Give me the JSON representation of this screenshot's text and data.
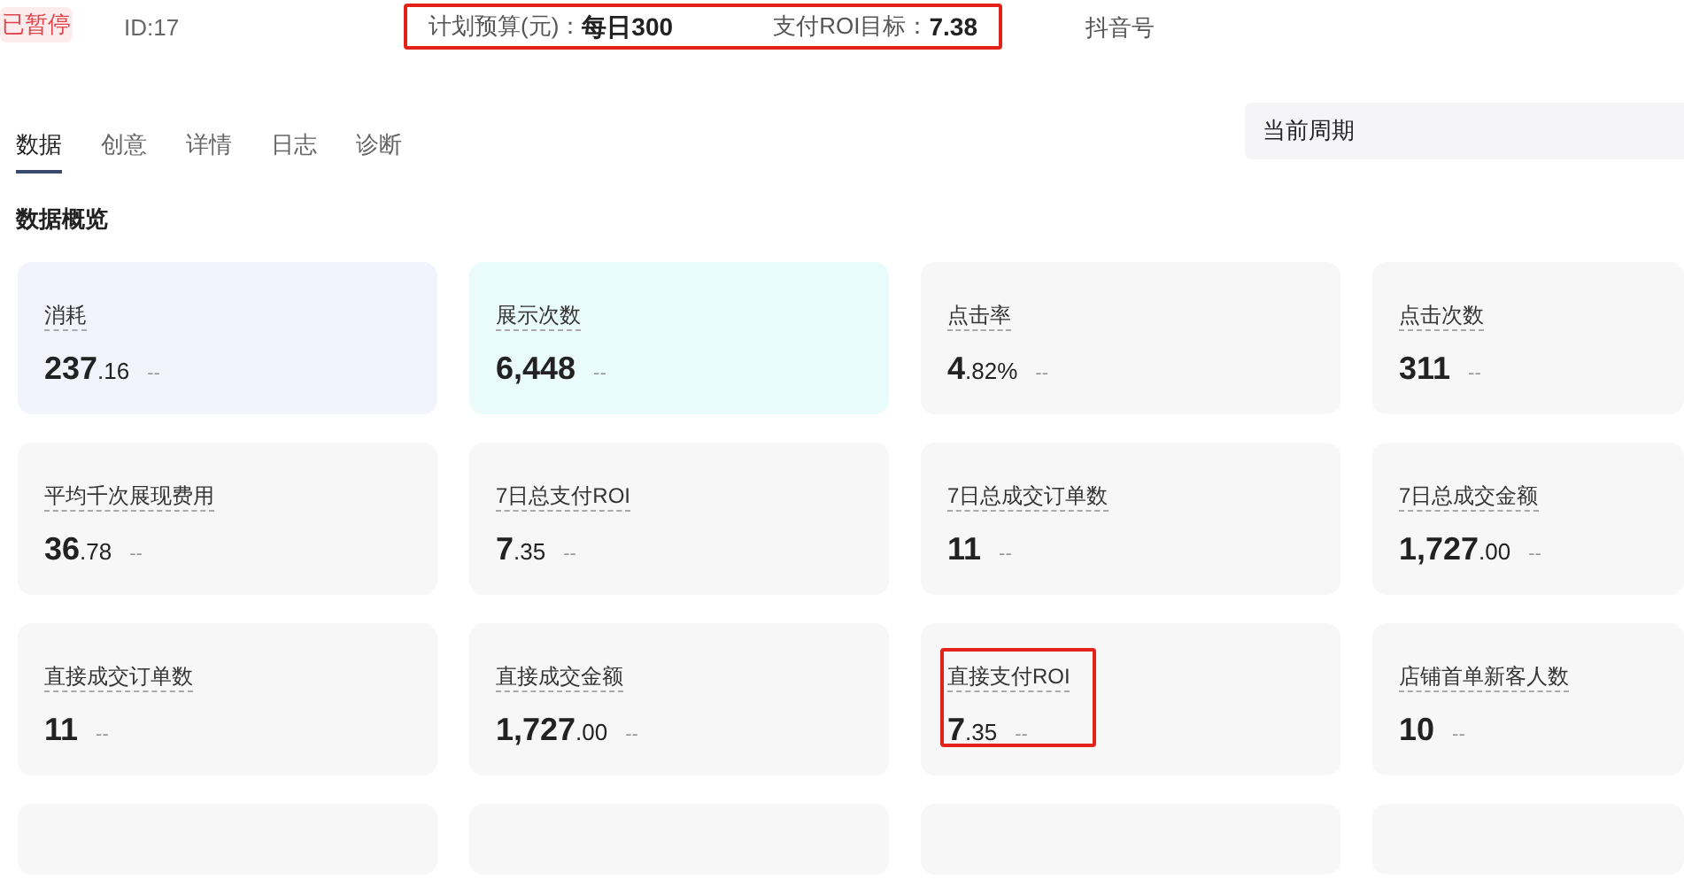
{
  "header": {
    "status_badge": "已暂停",
    "id_text": "ID:17",
    "budget_label": "计划预算(元)：",
    "budget_value": "每日300",
    "roi_label": "支付ROI目标：",
    "roi_value": "7.38",
    "highlighted": true,
    "account_label": "抖音号"
  },
  "tabs": [
    {
      "label": "数据",
      "selected": true
    },
    {
      "label": "创意",
      "selected": false
    },
    {
      "label": "详情",
      "selected": false
    },
    {
      "label": "日志",
      "selected": false
    },
    {
      "label": "诊断",
      "selected": false
    }
  ],
  "period_select": {
    "value": "当前周期"
  },
  "section_title": "数据概览",
  "metrics": [
    {
      "label": "消耗",
      "value_main": "237",
      "value_fraction": ".16",
      "change": "--",
      "color": "#f3f3fd",
      "highlighted": false
    },
    {
      "label": "展示次数",
      "value_main": "6,448",
      "change": "--",
      "color": "#e9fbfb",
      "highlighted": false
    },
    {
      "label": "点击率",
      "value_main": "4",
      "value_fraction": ".82%",
      "change": "--",
      "color": "#f7f7f8",
      "highlighted": false
    },
    {
      "label": "点击次数",
      "value_main": "311",
      "change": "--",
      "color": "#f7f7f8",
      "highlighted": false
    },
    {
      "label": "平均千次展现费用",
      "value_main": "36",
      "value_fraction": ".78",
      "change": "--",
      "color": "#f7f7f8",
      "highlighted": false
    },
    {
      "label": "7日总支付ROI",
      "value_main": "7",
      "value_fraction": ".35",
      "change": "--",
      "color": "#f7f7f8",
      "highlighted": false
    },
    {
      "label": "7日总成交订单数",
      "value_main": "11",
      "change": "--",
      "color": "#f7f7f8",
      "highlighted": false
    },
    {
      "label": "7日总成交金额",
      "value_main": "1,727",
      "value_fraction": ".00",
      "change": "--",
      "color": "#f7f7f8",
      "highlighted": false
    },
    {
      "label": "直接成交订单数",
      "value_main": "11",
      "change": "--",
      "color": "#f7f7f8",
      "highlighted": false
    },
    {
      "label": "直接成交金额",
      "value_main": "1,727",
      "value_fraction": ".00",
      "change": "--",
      "color": "#f7f7f8",
      "highlighted": false
    },
    {
      "label": "直接支付ROI",
      "value_main": "7",
      "value_fraction": ".35",
      "change": "--",
      "color": "#f7f7f8",
      "highlighted": true
    },
    {
      "label": "店铺首单新客人数",
      "value_main": "10",
      "change": "--",
      "color": "#f7f7f8",
      "highlighted": false
    }
  ]
}
